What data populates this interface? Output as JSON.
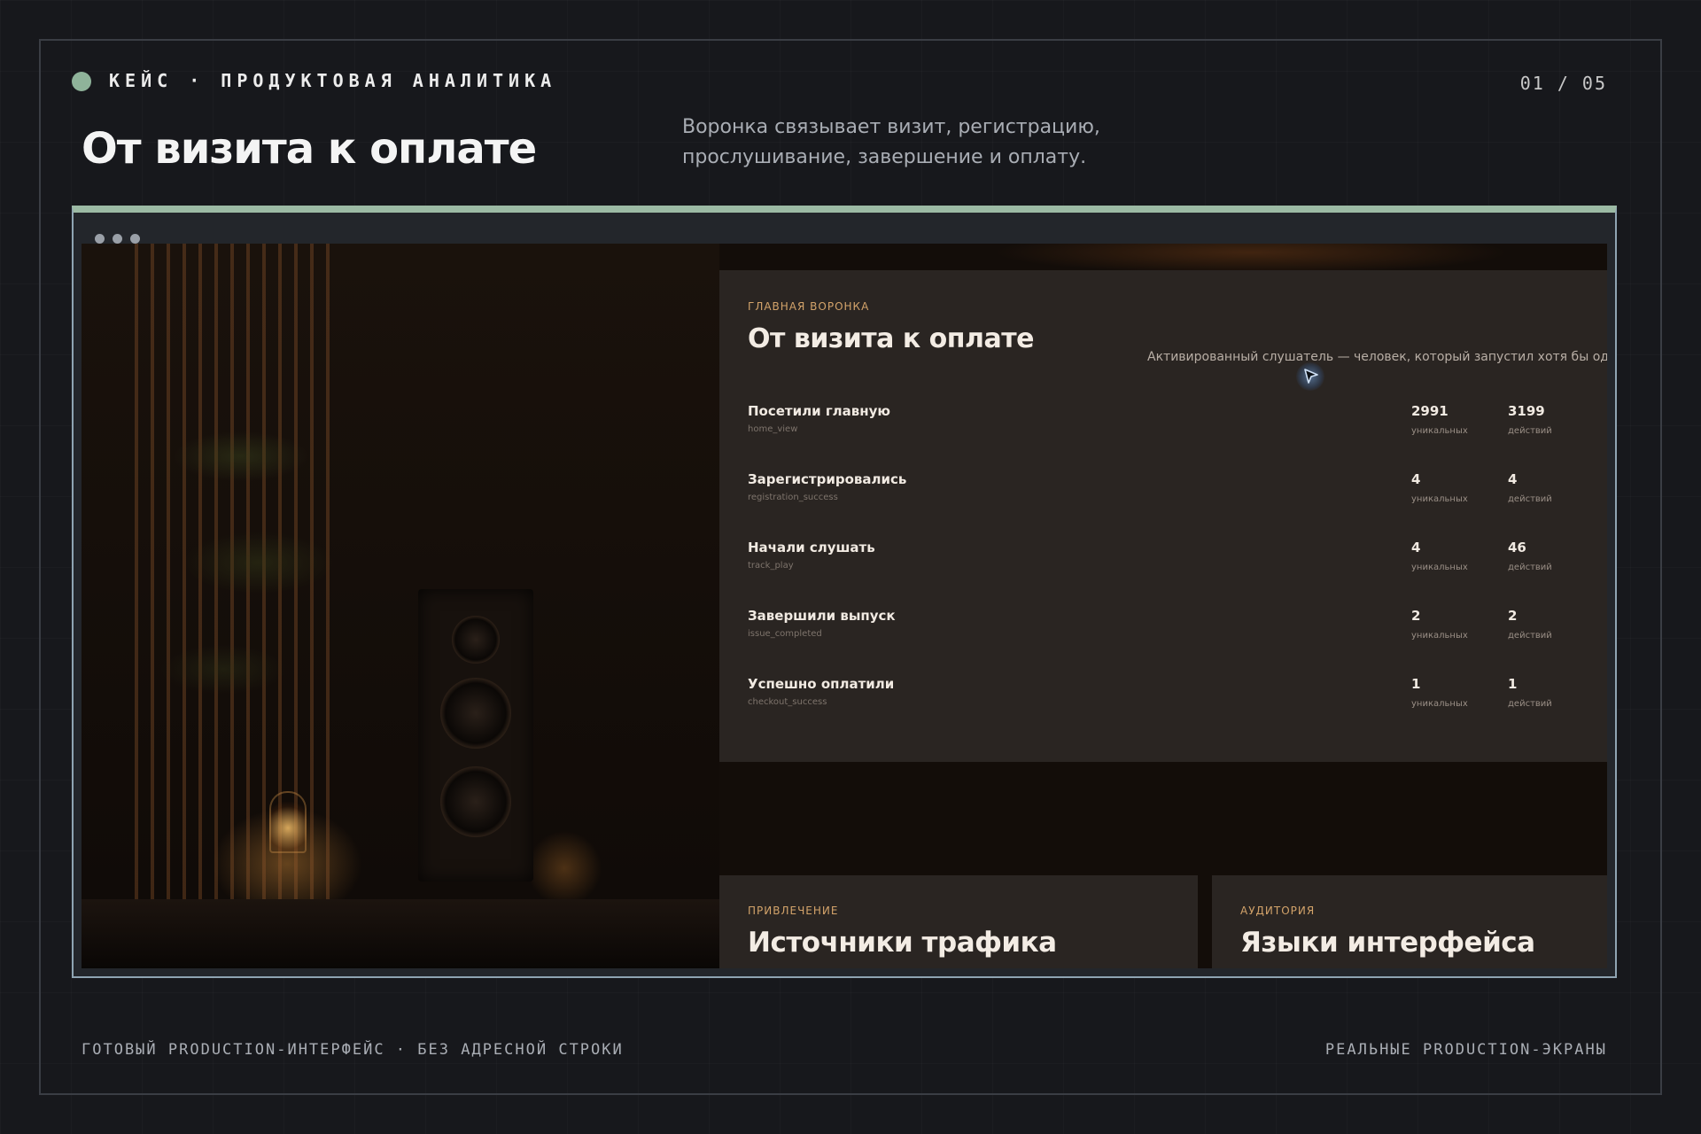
{
  "header": {
    "kicker": "КЕЙС · ПРОДУКТОВАЯ АНАЛИТИКА",
    "page_counter": "01 / 05",
    "title": "От визита к оплате",
    "description": "Воронка связывает визит, регистрацию, прослушивание, завершение и оплату."
  },
  "colors": {
    "accent": "#9cbaa4",
    "eyebrow": "#d3a36a",
    "panel_bg": "#2a2522"
  },
  "screen": {
    "funnel_panel": {
      "eyebrow": "ГЛАВНАЯ ВОРОНКА",
      "title": "От визита к оплате",
      "note": "Активированный слушатель — человек, который запустил хотя бы од",
      "rows": [
        {
          "label": "Посетили главную",
          "event": "home_view",
          "unique": "2991",
          "unique_unit": "уникальных",
          "actions": "3199",
          "actions_unit": "действий"
        },
        {
          "label": "Зарегистрировались",
          "event": "registration_success",
          "unique": "4",
          "unique_unit": "уникальных",
          "actions": "4",
          "actions_unit": "действий"
        },
        {
          "label": "Начали слушать",
          "event": "track_play",
          "unique": "4",
          "unique_unit": "уникальных",
          "actions": "46",
          "actions_unit": "действий"
        },
        {
          "label": "Завершили выпуск",
          "event": "issue_completed",
          "unique": "2",
          "unique_unit": "уникальных",
          "actions": "2",
          "actions_unit": "действий"
        },
        {
          "label": "Успешно оплатили",
          "event": "checkout_success",
          "unique": "1",
          "unique_unit": "уникальных",
          "actions": "1",
          "actions_unit": "действий"
        }
      ]
    },
    "cards": [
      {
        "eyebrow": "ПРИВЛЕЧЕНИЕ",
        "title": "Источники трафика"
      },
      {
        "eyebrow": "АУДИТОРИЯ",
        "title": "Языки интерфейса"
      }
    ]
  },
  "footer": {
    "left": "ГОТОВЫЙ PRODUCTION-ИНТЕРФЕЙС · БЕЗ АДРЕСНОЙ СТРОКИ",
    "right": "РЕАЛЬНЫЕ PRODUCTION-ЭКРАНЫ"
  }
}
